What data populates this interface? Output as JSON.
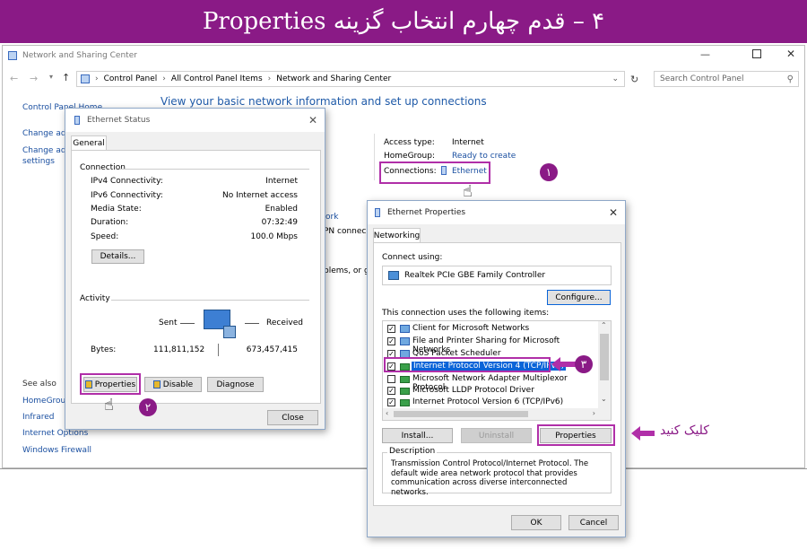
{
  "banner": {
    "title": "۴ – قدم چهارم انتخاب گزینه Properties"
  },
  "main": {
    "title": "Network and Sharing Center",
    "breadcrumb": [
      "Control Panel",
      "All Control Panel Items",
      "Network and Sharing Center"
    ],
    "search_placeholder": "Search Control Panel",
    "heading": "View your basic network information and set up connections",
    "sidebar_top": [
      "Control Panel Home",
      "Change ada",
      "Change adv",
      "settings"
    ],
    "see_also": "See also",
    "see_also_items": [
      "HomeGroup",
      "Infrared",
      "Internet Options",
      "Windows Firewall"
    ],
    "access_type_label": "Access type:",
    "access_type_value": "Internet",
    "homegroup_label": "HomeGroup:",
    "homegroup_value": "Ready to create",
    "connections_label": "Connections:",
    "connections_value": "Ethernet",
    "frag1": "ork",
    "frag2": "PN connec",
    "frag3": "blems, or g"
  },
  "status": {
    "title": "Ethernet Status",
    "tab": "General",
    "connection": "Connection",
    "rows": [
      {
        "label": "IPv4 Connectivity:",
        "value": "Internet"
      },
      {
        "label": "IPv6 Connectivity:",
        "value": "No Internet access"
      },
      {
        "label": "Media State:",
        "value": "Enabled"
      },
      {
        "label": "Duration:",
        "value": "07:32:49"
      },
      {
        "label": "Speed:",
        "value": "100.0 Mbps"
      }
    ],
    "details": "Details...",
    "activity": "Activity",
    "sent": "Sent",
    "received": "Received",
    "bytes_label": "Bytes:",
    "bytes_sent": "111,811,152",
    "bytes_received": "673,457,415",
    "properties": "Properties",
    "disable": "Disable",
    "diagnose": "Diagnose",
    "close": "Close"
  },
  "props": {
    "title": "Ethernet Properties",
    "tab": "Networking",
    "connect_using": "Connect using:",
    "adapter": "Realtek PCIe GBE Family Controller",
    "configure": "Configure...",
    "items_label": "This connection uses the following items:",
    "items": [
      {
        "label": "Client for Microsoft Networks",
        "checked": true
      },
      {
        "label": "File and Printer Sharing for Microsoft Networks",
        "checked": true
      },
      {
        "label": "QoS Packet Scheduler",
        "checked": true
      },
      {
        "label": "Internet Protocol Version 4 (TCP/IPv4)",
        "checked": true
      },
      {
        "label": "Microsoft Network Adapter Multiplexor Protocol",
        "checked": false
      },
      {
        "label": "Microsoft LLDP Protocol Driver",
        "checked": true
      },
      {
        "label": "Internet Protocol Version 6 (TCP/IPv6)",
        "checked": true
      }
    ],
    "install": "Install...",
    "uninstall": "Uninstall",
    "properties": "Properties",
    "description_label": "Description",
    "description": "Transmission Control Protocol/Internet Protocol. The default wide area network protocol that provides communication across diverse interconnected networks.",
    "ok": "OK",
    "cancel": "Cancel"
  },
  "annotations": {
    "badge1": "۱",
    "badge2": "۲",
    "badge3": "۳",
    "click_label": "کلیک کنید"
  },
  "colors": {
    "accent": "#8a1a86",
    "highlight": "#b02fa8",
    "link": "#1a4fa0",
    "selection": "#0a64d8"
  }
}
